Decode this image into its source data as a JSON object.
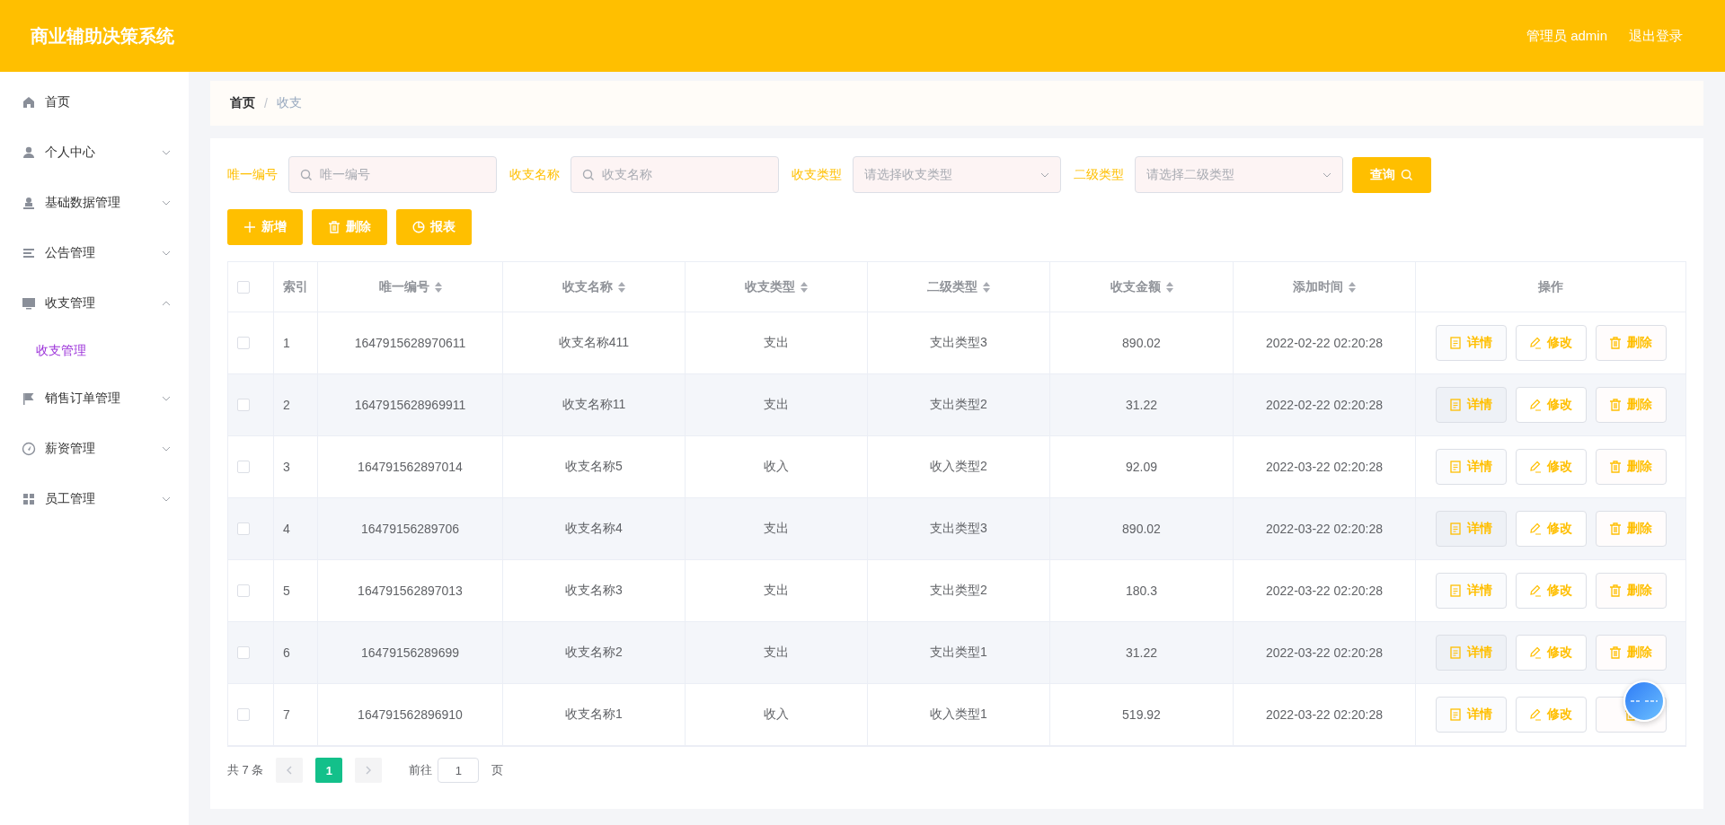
{
  "header": {
    "title": "商业辅助决策系统",
    "user": "管理员 admin",
    "logout": "退出登录"
  },
  "sidebar": {
    "items": [
      {
        "label": "首页",
        "has_children": false
      },
      {
        "label": "个人中心",
        "expanded": false,
        "has_children": true
      },
      {
        "label": "基础数据管理",
        "expanded": false,
        "has_children": true
      },
      {
        "label": "公告管理",
        "expanded": false,
        "has_children": true
      },
      {
        "label": "收支管理",
        "expanded": true,
        "has_children": true,
        "children": [
          {
            "label": "收支管理",
            "selected": true
          }
        ]
      },
      {
        "label": "销售订单管理",
        "expanded": false,
        "has_children": true
      },
      {
        "label": "薪资管理",
        "expanded": false,
        "has_children": true
      },
      {
        "label": "员工管理",
        "expanded": false,
        "has_children": true
      }
    ]
  },
  "breadcrumb": {
    "items": [
      "首页",
      "收支"
    ],
    "separator": "/"
  },
  "filters": [
    {
      "kind": "input",
      "label": "唯一编号",
      "placeholder": "唯一编号"
    },
    {
      "kind": "input",
      "label": "收支名称",
      "placeholder": "收支名称"
    },
    {
      "kind": "select",
      "label": "收支类型",
      "placeholder": "请选择收支类型"
    },
    {
      "kind": "select",
      "label": "二级类型",
      "placeholder": "请选择二级类型"
    }
  ],
  "search_button": "查询",
  "toolbar": [
    {
      "kind": "add",
      "label": "新增"
    },
    {
      "kind": "delete",
      "label": "删除"
    },
    {
      "kind": "report",
      "label": "报表"
    }
  ],
  "table": {
    "select_all_checked": false,
    "columns": [
      {
        "label": "索引",
        "sortable": false
      },
      {
        "label": "唯一编号",
        "sortable": true
      },
      {
        "label": "收支名称",
        "sortable": true
      },
      {
        "label": "收支类型",
        "sortable": true
      },
      {
        "label": "二级类型",
        "sortable": true
      },
      {
        "label": "收支金额",
        "sortable": true
      },
      {
        "label": "添加时间",
        "sortable": true
      },
      {
        "label": "操作",
        "sortable": false
      }
    ],
    "rows": [
      {
        "checked": false,
        "cells": [
          "1",
          "1647915628970611",
          "收支名称411",
          "支出",
          "支出类型3",
          "890.02",
          "2022-02-22 02:20:28"
        ],
        "actions": [
          {
            "kind": "detail",
            "label": "详情"
          },
          {
            "kind": "edit",
            "label": "修改"
          },
          {
            "kind": "delete",
            "label": "删除"
          }
        ]
      },
      {
        "checked": false,
        "cells": [
          "2",
          "1647915628969911",
          "收支名称11",
          "支出",
          "支出类型2",
          "31.22",
          "2022-02-22 02:20:28"
        ],
        "actions": [
          {
            "kind": "detail",
            "label": "详情"
          },
          {
            "kind": "edit",
            "label": "修改"
          },
          {
            "kind": "delete",
            "label": "删除"
          }
        ]
      },
      {
        "checked": false,
        "cells": [
          "3",
          "164791562897014",
          "收支名称5",
          "收入",
          "收入类型2",
          "92.09",
          "2022-03-22 02:20:28"
        ],
        "actions": [
          {
            "kind": "detail",
            "label": "详情"
          },
          {
            "kind": "edit",
            "label": "修改"
          },
          {
            "kind": "delete",
            "label": "删除"
          }
        ]
      },
      {
        "checked": false,
        "cells": [
          "4",
          "16479156289706",
          "收支名称4",
          "支出",
          "支出类型3",
          "890.02",
          "2022-03-22 02:20:28"
        ],
        "actions": [
          {
            "kind": "detail",
            "label": "详情"
          },
          {
            "kind": "edit",
            "label": "修改"
          },
          {
            "kind": "delete",
            "label": "删除"
          }
        ]
      },
      {
        "checked": false,
        "cells": [
          "5",
          "164791562897013",
          "收支名称3",
          "支出",
          "支出类型2",
          "180.3",
          "2022-03-22 02:20:28"
        ],
        "actions": [
          {
            "kind": "detail",
            "label": "详情"
          },
          {
            "kind": "edit",
            "label": "修改"
          },
          {
            "kind": "delete",
            "label": "删除"
          }
        ]
      },
      {
        "checked": false,
        "cells": [
          "6",
          "16479156289699",
          "收支名称2",
          "支出",
          "支出类型1",
          "31.22",
          "2022-03-22 02:20:28"
        ],
        "actions": [
          {
            "kind": "detail",
            "label": "详情"
          },
          {
            "kind": "edit",
            "label": "修改"
          },
          {
            "kind": "delete",
            "label": "删除"
          }
        ]
      },
      {
        "checked": false,
        "cells": [
          "7",
          "164791562896910",
          "收支名称1",
          "收入",
          "收入类型1",
          "519.92",
          "2022-03-22 02:20:28"
        ],
        "actions": [
          {
            "kind": "detail",
            "label": "详情"
          },
          {
            "kind": "edit",
            "label": "修改"
          },
          {
            "kind": "delete"
          }
        ]
      }
    ]
  },
  "pagination": {
    "total": "共 7 条",
    "pages": [
      {
        "label": "1",
        "selected": true
      }
    ],
    "goto_label": "前往",
    "goto_value": "1",
    "goto_suffix": "页"
  }
}
